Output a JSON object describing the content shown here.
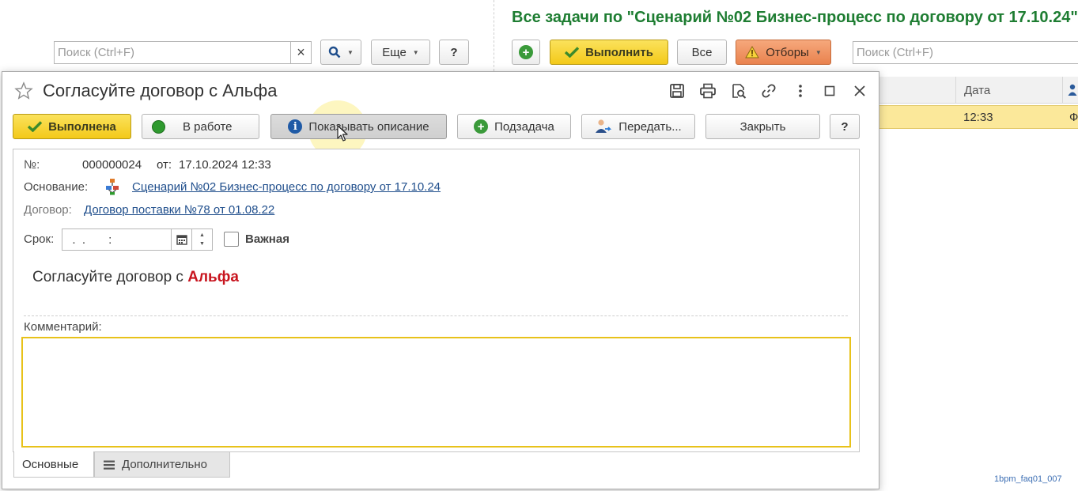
{
  "bg_list": {
    "title": "Все задачи по \"Сценарий №02 Бизнес-процесс по договору от 17.10.24\"",
    "search_placeholder": "Поиск (Ctrl+F)",
    "clear_symbol": "×",
    "more_label": "Еще",
    "help_label": "?",
    "execute_label": "Выполнить",
    "all_label": "Все",
    "filters_label": "Отборы",
    "right_search_placeholder": "Поиск (Ctrl+F)",
    "col_date": "Дата",
    "row_time": "12:33",
    "row_next": "Ф"
  },
  "form": {
    "title": "Согласуйте договор с Альфа",
    "buttons": {
      "done": "Выполнена",
      "in_work": "В работе",
      "show_desc": "Показывать описание",
      "subtask": "Подзадача",
      "transfer": "Передать...",
      "close": "Закрыть",
      "help": "?"
    },
    "number_label": "№:",
    "number_value": "000000024",
    "from_label": "от:",
    "from_value": "17.10.2024 12:33",
    "basis_label": "Основание:",
    "basis_link": "Сценарий №02 Бизнес-процесс по договору от 17.10.24",
    "contract_label": "Договор:",
    "contract_link": "Договор поставки №78 от 01.08.22",
    "term_label": "Срок:",
    "term_value": "  .  .       :",
    "important_label": "Важная",
    "important_checked": false,
    "desc_prefix": "Согласуйте договор с ",
    "desc_highlight": "Альфа",
    "comment_label": "Комментарий:",
    "comment_value": "",
    "tabs": [
      "Основные",
      "Дополнительно"
    ],
    "active_tab": 0
  },
  "watermark": "1bpm_faq01_007",
  "colors": {
    "title_green": "#1e7d32",
    "accent_yellow": "#f3c919",
    "link_blue": "#1f4e8c",
    "highlight_red": "#c8141e",
    "row_selected": "#fbe89a",
    "filters_orange": "#e9824e"
  }
}
